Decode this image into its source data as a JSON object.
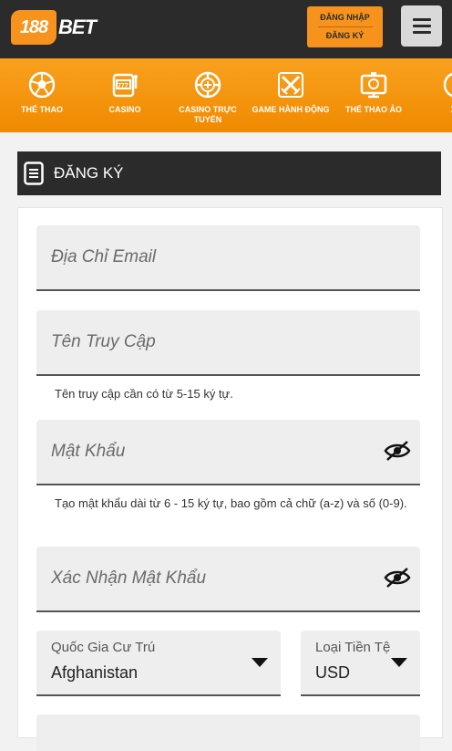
{
  "header": {
    "logo_number": "188",
    "logo_text": "BET",
    "login_label": "ĐĂNG NHẬP",
    "register_label": "ĐĂNG KÝ"
  },
  "nav": {
    "items": [
      {
        "label": "THỂ THAO",
        "icon": "soccer-ball-icon"
      },
      {
        "label": "CASINO",
        "icon": "slot-machine-icon"
      },
      {
        "label": "CASINO TRỰC TUYẾN",
        "icon": "casino-chip-icon"
      },
      {
        "label": "GAME HÀNH ĐỘNG",
        "icon": "crossed-swords-icon"
      },
      {
        "label": "THỂ THAO ẢO",
        "icon": "virtual-sports-screen-icon"
      },
      {
        "label": "XỔ",
        "icon": "lottery-ball-icon"
      }
    ]
  },
  "section": {
    "title": "ĐĂNG KÝ",
    "icon": "document-icon"
  },
  "form": {
    "email_placeholder": "Địa Chỉ Email",
    "username_placeholder": "Tên Truy Cập",
    "username_hint": "Tên truy cập cần có từ 5-15 ký tự.",
    "password_placeholder": "Mật Khẩu",
    "password_hint": "Tạo mật khẩu dài từ 6 - 15 ký tự, bao gồm cả chữ (a-z) và số (0-9).",
    "confirm_placeholder": "Xác Nhận Mật Khẩu",
    "country_label": "Quốc Gia Cư Trú",
    "country_value": "Afghanistan",
    "currency_label": "Loại Tiền Tệ",
    "currency_value": "USD"
  },
  "colors": {
    "accent": "#f7931d",
    "dark": "#2b2b2b",
    "field_bg": "#eeeeee"
  }
}
